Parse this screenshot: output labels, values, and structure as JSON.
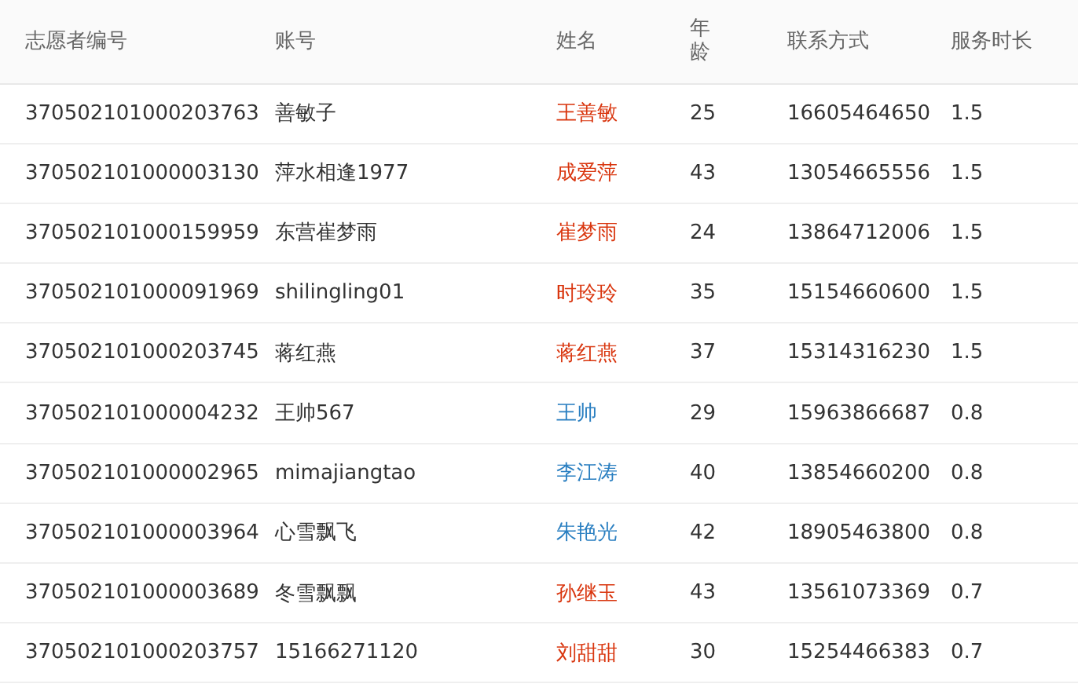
{
  "table": {
    "columns": [
      "志愿者编号",
      "账号",
      "姓名",
      "年龄",
      "联系方式",
      "服务时长"
    ],
    "rows": [
      {
        "id": "370502101000203763",
        "account": "善敏子",
        "name": "王善敏",
        "color": "#d9360f",
        "age": "25",
        "phone": "16605464650",
        "hours": "1.5"
      },
      {
        "id": "370502101000003130",
        "account": "萍水相逢1977",
        "name": "成爱萍",
        "color": "#d9360f",
        "age": "43",
        "phone": "13054665556",
        "hours": "1.5"
      },
      {
        "id": "370502101000159959",
        "account": "东营崔梦雨",
        "name": "崔梦雨",
        "color": "#d9360f",
        "age": "24",
        "phone": "13864712006",
        "hours": "1.5"
      },
      {
        "id": "370502101000091969",
        "account": "shilingling01",
        "name": "时玲玲",
        "color": "#d9360f",
        "age": "35",
        "phone": "15154660600",
        "hours": "1.5"
      },
      {
        "id": "370502101000203745",
        "account": "蒋红燕",
        "name": "蒋红燕",
        "color": "#d9360f",
        "age": "37",
        "phone": "15314316230",
        "hours": "1.5"
      },
      {
        "id": "370502101000004232",
        "account": "王帅567",
        "name": "王帅",
        "color": "#2a7fc1",
        "age": "29",
        "phone": "15963866687",
        "hours": "0.8"
      },
      {
        "id": "370502101000002965",
        "account": "mimajiangtao",
        "name": "李江涛",
        "color": "#2a7fc1",
        "age": "40",
        "phone": "13854660200",
        "hours": "0.8"
      },
      {
        "id": "370502101000003964",
        "account": "心雪飘飞",
        "name": "朱艳光",
        "color": "#2a7fc1",
        "age": "42",
        "phone": "18905463800",
        "hours": "0.8"
      },
      {
        "id": "370502101000003689",
        "account": "冬雪飘飘",
        "name": "孙继玉",
        "color": "#d9360f",
        "age": "43",
        "phone": "13561073369",
        "hours": "0.7"
      },
      {
        "id": "370502101000203757",
        "account": "15166271120",
        "name": "刘甜甜",
        "color": "#d9360f",
        "age": "30",
        "phone": "15254466383",
        "hours": "0.7"
      }
    ]
  }
}
